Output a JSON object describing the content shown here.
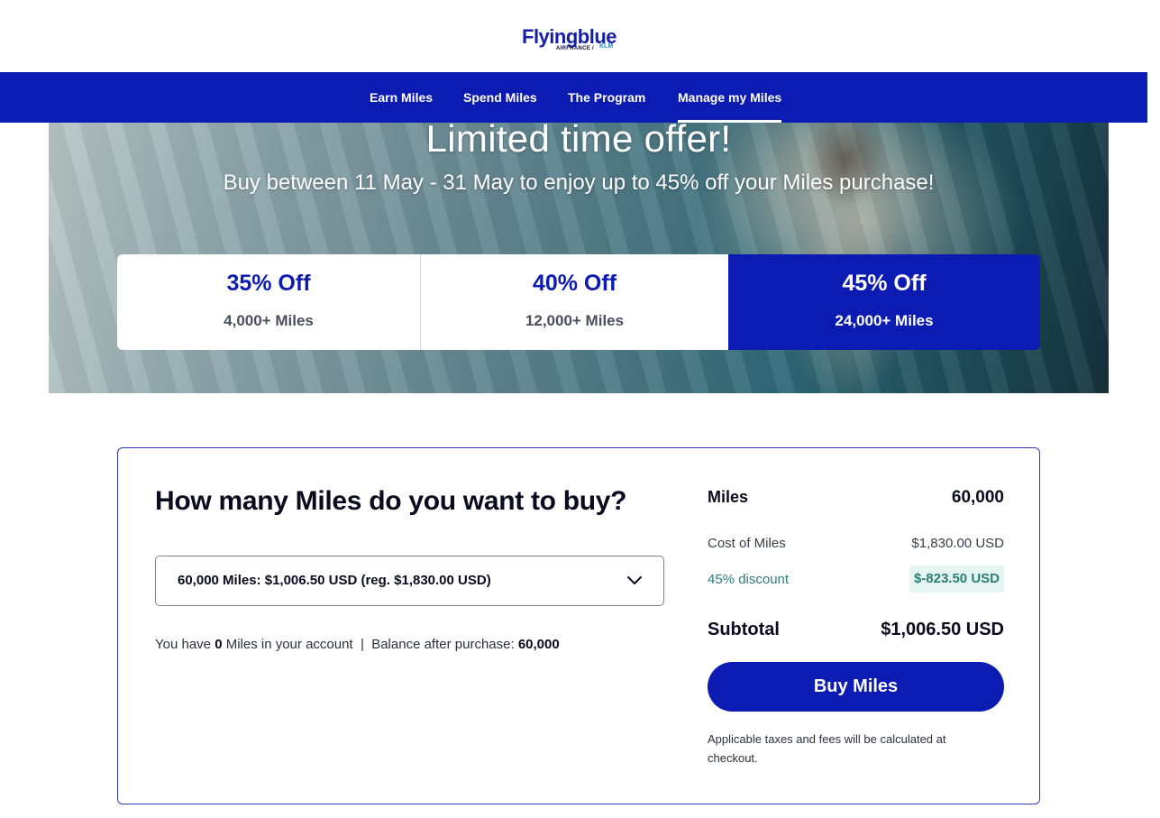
{
  "brand": {
    "name": "Flyingblue",
    "sub": "AIRFRANCE /",
    "partner": "KLM"
  },
  "nav": {
    "items": [
      {
        "label": "Earn Miles"
      },
      {
        "label": "Spend Miles"
      },
      {
        "label": "The Program"
      },
      {
        "label": "Manage my Miles"
      }
    ],
    "active": "Manage my Miles"
  },
  "hero": {
    "title": "Limited time offer!",
    "subtitle": "Buy between 11 May - 31 May to enjoy up to 45% off your Miles purchase!",
    "tiers": [
      {
        "discount": "35% Off",
        "threshold": "4,000+ Miles",
        "selected": false
      },
      {
        "discount": "40% Off",
        "threshold": "12,000+ Miles",
        "selected": false
      },
      {
        "discount": "45% Off",
        "threshold": "24,000+ Miles",
        "selected": true
      }
    ]
  },
  "purchase": {
    "question": "How many Miles do you want to buy?",
    "selected_option": "60,000 Miles: $1,006.50 USD (reg. $1,830.00 USD)",
    "balance": {
      "prefix": "You have",
      "current": "0",
      "current_suffix": "Miles in your account",
      "separator": "|",
      "after_label": "Balance after purchase:",
      "after_value": "60,000"
    }
  },
  "summary": {
    "miles_label": "Miles",
    "miles_value": "60,000",
    "cost_label": "Cost of Miles",
    "cost_value": "$1,830.00 USD",
    "discount_label": "45% discount",
    "discount_value": "$-823.50 USD",
    "subtotal_label": "Subtotal",
    "subtotal_value": "$1,006.50 USD",
    "buy_button": "Buy Miles",
    "note": "Applicable taxes and fees will be calculated at checkout."
  },
  "colors": {
    "primary": "#0c1cb2",
    "discount_text": "#2a7e74",
    "discount_bg": "#e3f4f1"
  },
  "icons": {
    "select_chevron": "chevron-down-icon"
  }
}
